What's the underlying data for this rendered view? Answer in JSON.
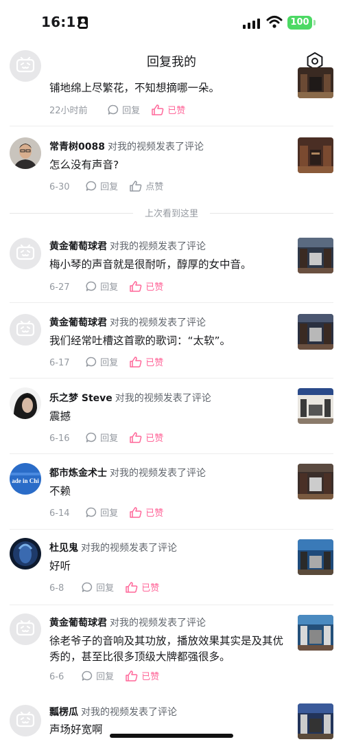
{
  "status_bar": {
    "time": "16:11",
    "battery": "100"
  },
  "nav": {
    "title": "回复我的"
  },
  "divider_text": "上次看到这里",
  "colors": {
    "liked": "#ff6699",
    "battery": "#4cd964"
  },
  "items": [
    {
      "name": "",
      "action": "",
      "content": "铺地绵上尽繁花，不知想摘哪一朵。",
      "date": "22小时前",
      "reply": "回复",
      "like": "已赞",
      "liked": true,
      "avatar": "default-tv-avatar"
    },
    {
      "name": "常青树0088",
      "action": "对我的视频发表了评论",
      "content": "怎么没有声音?",
      "date": "6-30",
      "reply": "回复",
      "like": "点赞",
      "liked": false,
      "avatar": "photo-man"
    },
    {
      "name": "黄金葡萄球君",
      "action": "对我的视频发表了评论",
      "content": "梅小琴的声音就是很耐听，醇厚的女中音。",
      "date": "6-27",
      "reply": "回复",
      "like": "已赞",
      "liked": true,
      "avatar": "default-tv-avatar"
    },
    {
      "name": "黄金葡萄球君",
      "action": "对我的视频发表了评论",
      "content": "我们经常吐槽这首歌的歌词：“太软”。",
      "date": "6-17",
      "reply": "回复",
      "like": "已赞",
      "liked": true,
      "avatar": "default-tv-avatar"
    },
    {
      "name": "乐之梦 Steve",
      "action": "对我的视频发表了评论",
      "content": "震撼",
      "date": "6-16",
      "reply": "回复",
      "like": "已赞",
      "liked": true,
      "avatar": "photo-portrait"
    },
    {
      "name": "都市炼金术士",
      "action": "对我的视频发表了评论",
      "content": "不赖",
      "date": "6-14",
      "reply": "回复",
      "like": "已赞",
      "liked": true,
      "avatar": "made-in-china",
      "avatar_text": "ade in Chi"
    },
    {
      "name": "杜见鬼",
      "action": "对我的视频发表了评论",
      "content": "好听",
      "date": "6-8",
      "reply": "回复",
      "like": "已赞",
      "liked": true,
      "avatar": "photo-blue"
    },
    {
      "name": "黄金葡萄球君",
      "action": "对我的视频发表了评论",
      "content": "徐老爷子的音响及其功放，播放效果其实是及其优秀的，甚至比很多顶级大牌都强很多。",
      "date": "6-6",
      "reply": "回复",
      "like": "已赞",
      "liked": true,
      "avatar": "default-tv-avatar"
    },
    {
      "name": "瓢楞瓜",
      "action": "对我的视频发表了评论",
      "content": "声场好宽啊",
      "date": "",
      "reply": "",
      "like": "",
      "liked": false,
      "avatar": "default-tv-avatar"
    }
  ]
}
